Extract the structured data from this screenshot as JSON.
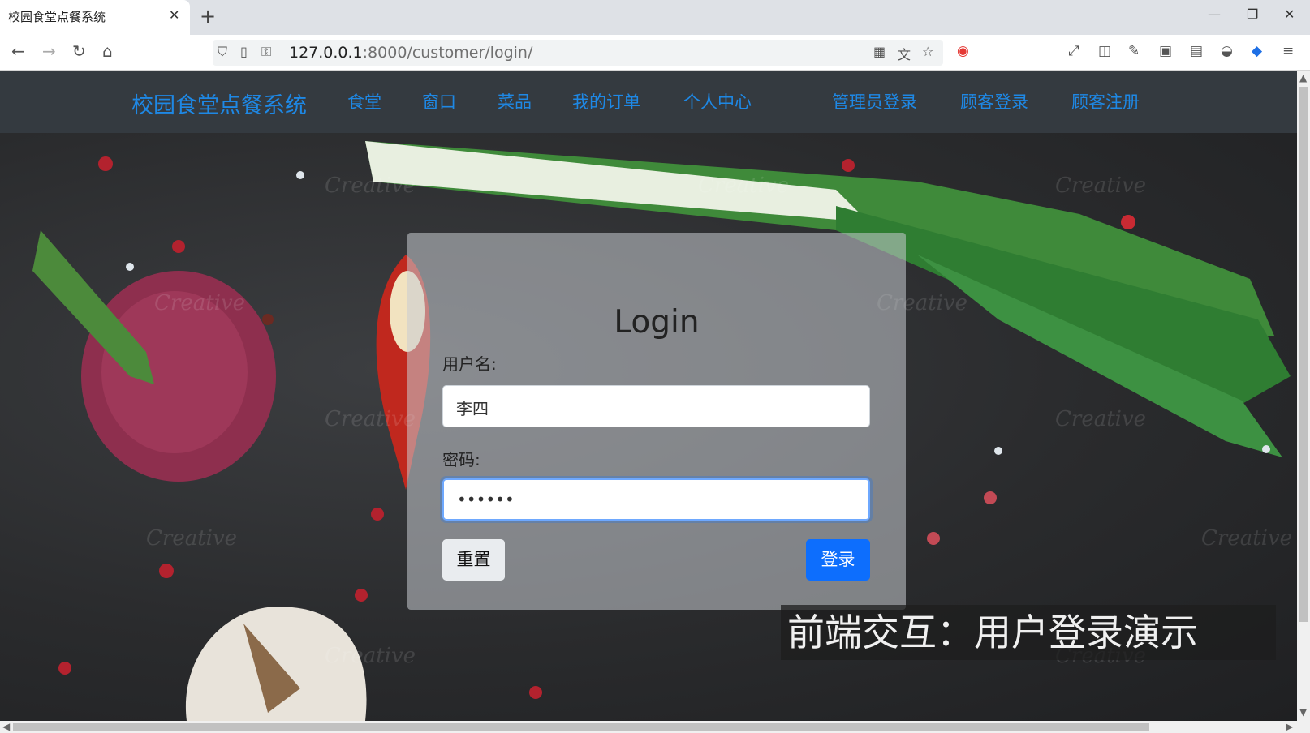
{
  "browser": {
    "tab_title": "校园食堂点餐系统",
    "tab_close": "✕",
    "new_tab": "+",
    "url_host": "127.0.0.1",
    "url_rest": ":8000/customer/login/",
    "window_controls": {
      "minimize": "—",
      "restore": "❐",
      "close": "✕"
    },
    "nav": {
      "back": "←",
      "forward": "→",
      "reload": "↻",
      "home": "⌂"
    }
  },
  "navbar": {
    "brand": "校园食堂点餐系统",
    "links": [
      "食堂",
      "窗口",
      "菜品",
      "我的订单",
      "个人中心"
    ],
    "right_links": [
      "管理员登录",
      "顾客登录",
      "顾客注册"
    ]
  },
  "login": {
    "title": "Login",
    "username_label": "用户名:",
    "username_value": "李四",
    "password_label": "密码:",
    "password_value": "••••••",
    "reset_label": "重置",
    "submit_label": "登录"
  },
  "caption": "前端交互：用户登录演示",
  "watermark": "Creative",
  "colors": {
    "navbar_bg": "#343a40",
    "link": "#1e88e5",
    "primary": "#0d6efd"
  }
}
